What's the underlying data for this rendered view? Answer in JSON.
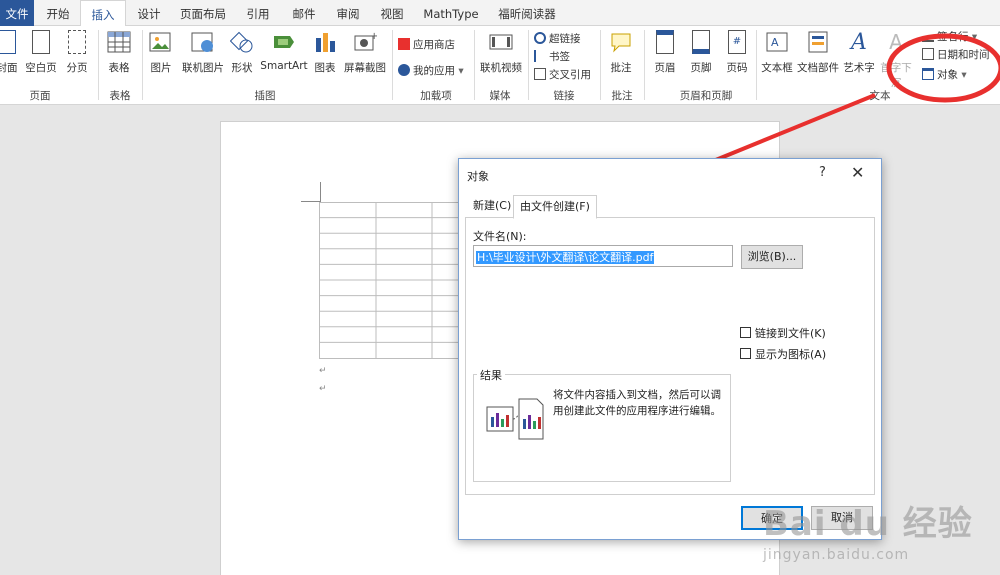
{
  "tabs": [
    {
      "id": "file",
      "label": "文件"
    },
    {
      "id": "home",
      "label": "开始"
    },
    {
      "id": "insert",
      "label": "插入"
    },
    {
      "id": "design",
      "label": "设计"
    },
    {
      "id": "layout",
      "label": "页面布局"
    },
    {
      "id": "references",
      "label": "引用"
    },
    {
      "id": "mailings",
      "label": "邮件"
    },
    {
      "id": "review",
      "label": "审阅"
    },
    {
      "id": "view",
      "label": "视图"
    },
    {
      "id": "mathtype",
      "label": "MathType"
    },
    {
      "id": "foxit",
      "label": "福昕阅读器"
    }
  ],
  "ribbon": {
    "pages": {
      "cover": "封面",
      "blank": "空白页",
      "break": "分页",
      "label": "页面"
    },
    "tables": {
      "table": "表格",
      "label": "表格"
    },
    "illustrations": {
      "picture": "图片",
      "online_picture": "联机图片",
      "shapes": "形状",
      "smartart": "SmartArt",
      "chart": "图表",
      "screenshot": "屏幕截图",
      "label": "插图"
    },
    "addins": {
      "store": "应用商店",
      "my_apps": "我的应用",
      "label": "加载项"
    },
    "media": {
      "online_video": "联机视频",
      "label": "媒体"
    },
    "links": {
      "hyperlink": "超链接",
      "bookmark": "书签",
      "cross_ref": "交叉引用",
      "label": "链接"
    },
    "comments": {
      "comment": "批注",
      "label": "批注"
    },
    "header_footer": {
      "header": "页眉",
      "footer": "页脚",
      "page_number": "页码",
      "label": "页眉和页脚"
    },
    "text": {
      "textbox": "文本框",
      "quick_parts": "文档部件",
      "wordart": "艺术字",
      "dropcap": "首字下沉",
      "signature_line": "签名行",
      "date_time": "日期和时间",
      "object": "对象",
      "label": "文本"
    }
  },
  "dialog": {
    "title": "对象",
    "help": "?",
    "close": "✕",
    "tabs": {
      "create_new": "新建(C)",
      "from_file": "由文件创建(F)"
    },
    "file_name_label": "文件名(N):",
    "file_name_value": "H:\\毕业设计\\外文翻译\\论文翻译.pdf",
    "browse": "浏览(B)...",
    "link_to_file": "链接到文件(K)",
    "display_as_icon": "显示为图标(A)",
    "result_label": "结果",
    "result_text": "将文件内容插入到文档，然后可以调用创建此文件的应用程序进行编辑。",
    "ok": "确定",
    "cancel": "取消"
  },
  "document": {
    "para_mark": "↵"
  },
  "watermark": {
    "brand": "Bai du 经验",
    "url": "jingyan.baidu.com"
  },
  "colors": {
    "accent": "#2b579a",
    "annotation": "#e8302e",
    "selection": "#3399ff"
  }
}
